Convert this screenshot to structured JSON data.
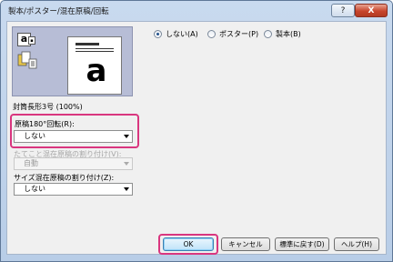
{
  "window": {
    "title": "製本/ポスター/混在原稿/回転",
    "help_label": "?",
    "close_label": "X"
  },
  "preview": {
    "page_letter": "a",
    "small_icon_letter": "a",
    "paper_label": "封筒長形3号 (100%)"
  },
  "rotate": {
    "label": "原稿180°回転(R):",
    "value": "しない"
  },
  "mixed_paper": {
    "label": "たてこと混在原稿の割り付け(V):",
    "value": "自動"
  },
  "size_mixed": {
    "label": "サイズ混在原稿の割り付け(Z):",
    "value": "しない"
  },
  "layout_mode": {
    "options": [
      {
        "label": "しない(A)",
        "selected": true
      },
      {
        "label": "ポスター(P)",
        "selected": false
      },
      {
        "label": "製本(B)",
        "selected": false
      }
    ]
  },
  "buttons": {
    "ok": "OK",
    "cancel": "キャンセル",
    "restore": "標準に戻す(D)",
    "help": "ヘルプ(H)"
  },
  "colors": {
    "highlight": "#d9367f"
  }
}
